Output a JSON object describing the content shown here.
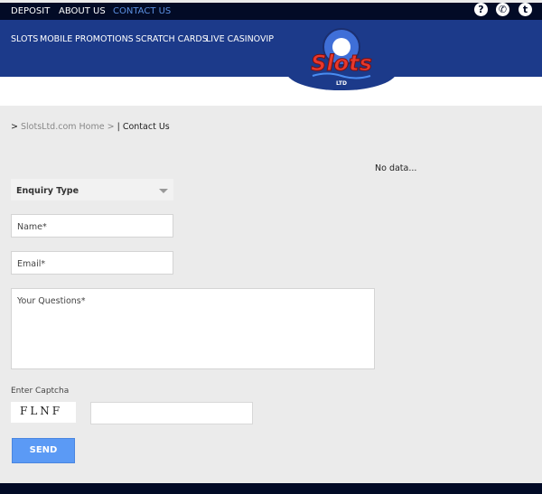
{
  "top_nav": [
    "DEPOSIT",
    "ABOUT US",
    "CONTACT US"
  ],
  "top_icons": [
    "help-icon",
    "phone-icon",
    "tumblr-icon"
  ],
  "main_nav": [
    "SLOTS",
    "MOBILE",
    "PROMOTIONS",
    "SCRATCH CARDS",
    "LIVE CASINO",
    "VIP"
  ],
  "logo": {
    "text": "Slots",
    "sub": "LTD"
  },
  "breadcrumb": {
    "prefix": ">",
    "home": "SlotsLtd.com Home",
    "sep": ">",
    "current": "| Contact Us"
  },
  "status": "No data...",
  "form": {
    "enquiry": "Enquiry Type",
    "name": "Name*",
    "email": "Email*",
    "questions": "Your Questions*",
    "captcha_label": "Enter Captcha",
    "captcha": "FLNF",
    "send": "SEND"
  },
  "colors": {
    "dark": "#020b26",
    "nav": "#1c3a8a",
    "accent": "#5b9af5"
  }
}
